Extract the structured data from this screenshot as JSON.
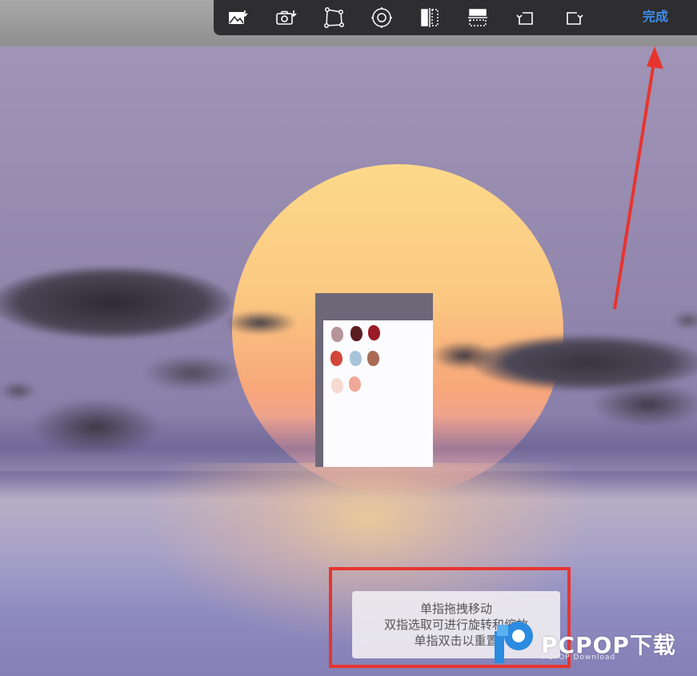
{
  "toolbar": {
    "tools": [
      {
        "icon": "insert-image-icon"
      },
      {
        "icon": "insert-photo-icon"
      },
      {
        "icon": "free-transform-icon"
      },
      {
        "icon": "rotate-center-icon"
      },
      {
        "icon": "flip-horizontal-icon"
      },
      {
        "icon": "flip-vertical-icon"
      },
      {
        "icon": "rotate-left-icon"
      },
      {
        "icon": "rotate-right-icon"
      }
    ],
    "done_label": "完成",
    "done_color": "#3d8ff0"
  },
  "hint": {
    "line1": "单指拖拽移动",
    "line2": "双指选取可进行旋转和缩放",
    "line3": "单指双击以重置"
  },
  "watermark": {
    "brand": "PCPOP下载",
    "sub": "PCPOP Download"
  },
  "annotation": {
    "highlight_color": "#e8342f"
  },
  "reference_panel": {
    "swatch_colors": [
      "#b7949a",
      "#5a1e22",
      "#9a1b28",
      "#d2473a",
      "#a8c4d8",
      "#a86a55",
      "#f6dad2",
      "#f0a898"
    ]
  }
}
